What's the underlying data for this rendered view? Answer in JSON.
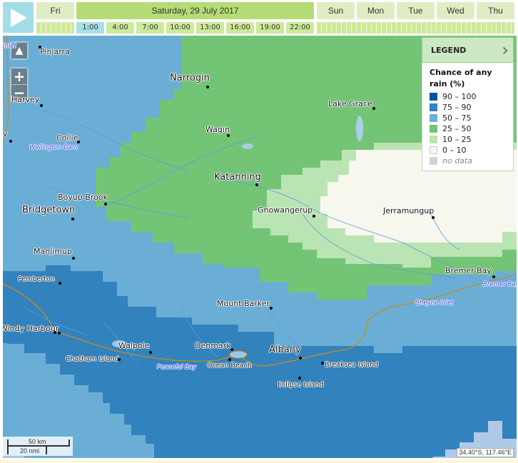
{
  "timeline": {
    "play_icon": "play-icon",
    "days": [
      {
        "label": "Fri"
      },
      {
        "label": "Saturday, 29 July 2017",
        "active": true
      },
      {
        "label": "Sun"
      },
      {
        "label": "Mon"
      },
      {
        "label": "Tue"
      },
      {
        "label": "Wed"
      },
      {
        "label": "Thu"
      }
    ],
    "hours": [
      "1:00",
      "4:00",
      "7:00",
      "10:00",
      "13:00",
      "16:00",
      "19:00",
      "22:00"
    ],
    "active_hour": "1:00"
  },
  "map_controls": {
    "home_icon": "australia-icon",
    "zoom_in": "+",
    "zoom_out": "−"
  },
  "legend": {
    "header": "LEGEND",
    "toggle_icon": "chevron-right-icon",
    "title": "Chance of any rain (%)",
    "items": [
      {
        "label": "90 – 100",
        "color": "#08519c"
      },
      {
        "label": "75 – 90",
        "color": "#3182bd"
      },
      {
        "label": "50 – 75",
        "color": "#6baed6"
      },
      {
        "label": "25 – 50",
        "color": "#74c476"
      },
      {
        "label": "10 – 25",
        "color": "#bae4b3"
      },
      {
        "label": "0 – 10",
        "color": "#f7f7ee"
      },
      {
        "label": "no data",
        "color": "#d3d3d3"
      }
    ]
  },
  "places": {
    "pinjarra": "Pinjarra",
    "harvey": "Harvey",
    "collie": "Collie",
    "narrogin": "Narrogin",
    "wagin": "Wagin",
    "lake_grace": "Lake Grace",
    "katanning": "Katanning",
    "boyup_brook": "Boyup Brook",
    "bridgetown": "Bridgetown",
    "gnowangerup": "Gnowangerup",
    "jerramungup": "Jerramungup",
    "manjimup": "Manjimup",
    "pemberton": "Pemberton",
    "bremer_bay": "Bremer Bay",
    "mount_barker": "Mount Barker",
    "windy_harbour": "Windy Harbour",
    "walpole": "Walpole",
    "denmark": "Denmark",
    "albany": "Albany",
    "chatham_island": "Chatham Island",
    "ocean_beach": "Ocean Beach",
    "breaksea_island": "Breaksea Island",
    "eclipse_island": "Eclipse Island",
    "partial_west": "y"
  },
  "water_labels": {
    "wellington_dam": "Wellington Dam",
    "peaceful_bay": "Peaceful Bay",
    "cheyne_inlet": "Cheyne Inlet",
    "bremer_bay_water": "Bremer Bay",
    "inlet_top": "Inlet"
  },
  "scale": {
    "km": "50 km",
    "nmi": "20 nmi"
  },
  "coordinates": "34.40°S, 117.46°E"
}
